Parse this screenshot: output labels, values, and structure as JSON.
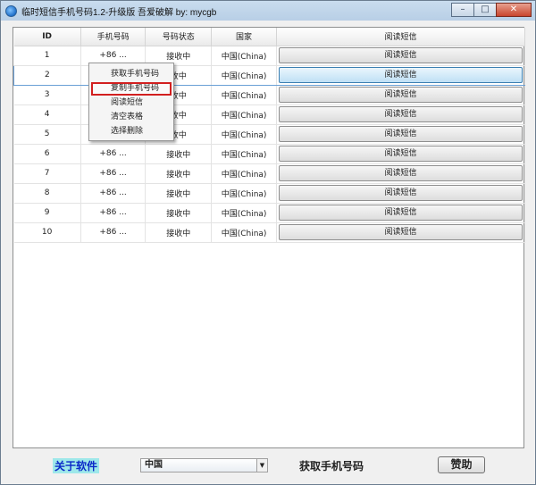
{
  "window": {
    "title": "临时短信手机号码1.2-升级版 吾爱破解 by: mycgb",
    "min_icon": "minimize-icon",
    "max_icon": "maximize-icon",
    "close_icon": "close-icon",
    "min_glyph": "–",
    "max_glyph": "□",
    "close_glyph": "✕"
  },
  "table": {
    "headers": [
      "ID",
      "手机号码",
      "号码状态",
      "国家",
      "阅读短信"
    ],
    "rows": [
      {
        "id": "1",
        "phone": "+86 ...",
        "status": "接收中",
        "country": "中国(China)",
        "action": "阅读短信"
      },
      {
        "id": "2",
        "phone": "",
        "status": "收中",
        "country": "中国(China)",
        "action": "阅读短信"
      },
      {
        "id": "3",
        "phone": "",
        "status": "收中",
        "country": "中国(China)",
        "action": "阅读短信"
      },
      {
        "id": "4",
        "phone": "",
        "status": "收中",
        "country": "中国(China)",
        "action": "阅读短信"
      },
      {
        "id": "5",
        "phone": "",
        "status": "收中",
        "country": "中国(China)",
        "action": "阅读短信"
      },
      {
        "id": "6",
        "phone": "+86 ...",
        "status": "接收中",
        "country": "中国(China)",
        "action": "阅读短信"
      },
      {
        "id": "7",
        "phone": "+86 ...",
        "status": "接收中",
        "country": "中国(China)",
        "action": "阅读短信"
      },
      {
        "id": "8",
        "phone": "+86 ...",
        "status": "接收中",
        "country": "中国(China)",
        "action": "阅读短信"
      },
      {
        "id": "9",
        "phone": "+86 ...",
        "status": "接收中",
        "country": "中国(China)",
        "action": "阅读短信"
      },
      {
        "id": "10",
        "phone": "+86 ...",
        "status": "接收中",
        "country": "中国(China)",
        "action": "阅读短信"
      }
    ]
  },
  "context_menu": {
    "items": [
      "获取手机号码",
      "复制手机号码",
      "阅读短信",
      "清空表格",
      "选择删除"
    ],
    "highlighted": "复制手机号码"
  },
  "bottom": {
    "about": "关于软件",
    "country_value": "中国",
    "get_number": "获取手机号码",
    "donate": "赞助"
  },
  "colors": {
    "selection_border": "#6aa0d6",
    "highlight_outline": "#d21f1f",
    "about_link": "#0a28c8"
  }
}
